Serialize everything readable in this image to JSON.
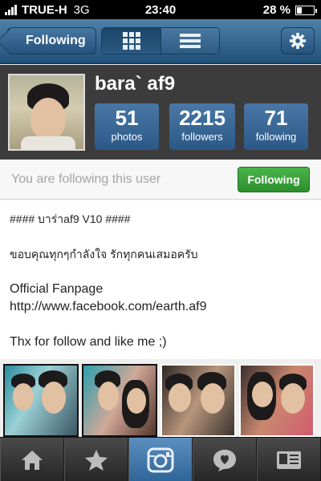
{
  "status_bar": {
    "carrier": "TRUE-H",
    "network": "3G",
    "time": "23:40",
    "battery": "28 %",
    "battery_level": 0.28
  },
  "navbar": {
    "back_label": "Following",
    "view_modes": [
      "grid-icon",
      "list-icon"
    ],
    "active_view": "grid",
    "settings_icon": "gear-icon"
  },
  "profile": {
    "username": "bara` af9",
    "stats": [
      {
        "value": "51",
        "label": "photos"
      },
      {
        "value": "2215",
        "label": "followers"
      },
      {
        "value": "71",
        "label": "following"
      }
    ]
  },
  "follow_bar": {
    "text": "You are following this user",
    "button_label": "Following",
    "button_color": "#3aa53a"
  },
  "bio": {
    "line1": "#### บาร่าaf9 V10 ####",
    "line2": "ขอบคุณทุกๆกำลังใจ รักทุกคนเสมอครับ",
    "line3": "Official Fanpage",
    "line4": "http://www.facebook.com/earth.af9",
    "line5": "Thx for follow and like me ;)"
  },
  "tabbar": {
    "items": [
      "home-icon",
      "star-icon",
      "camera-icon",
      "activity-icon",
      "profile-icon"
    ],
    "active_index": 2
  },
  "colors": {
    "nav_blue": "#2f6496",
    "stat_blue": "#3a6a98",
    "follow_green": "#3aa53a"
  }
}
